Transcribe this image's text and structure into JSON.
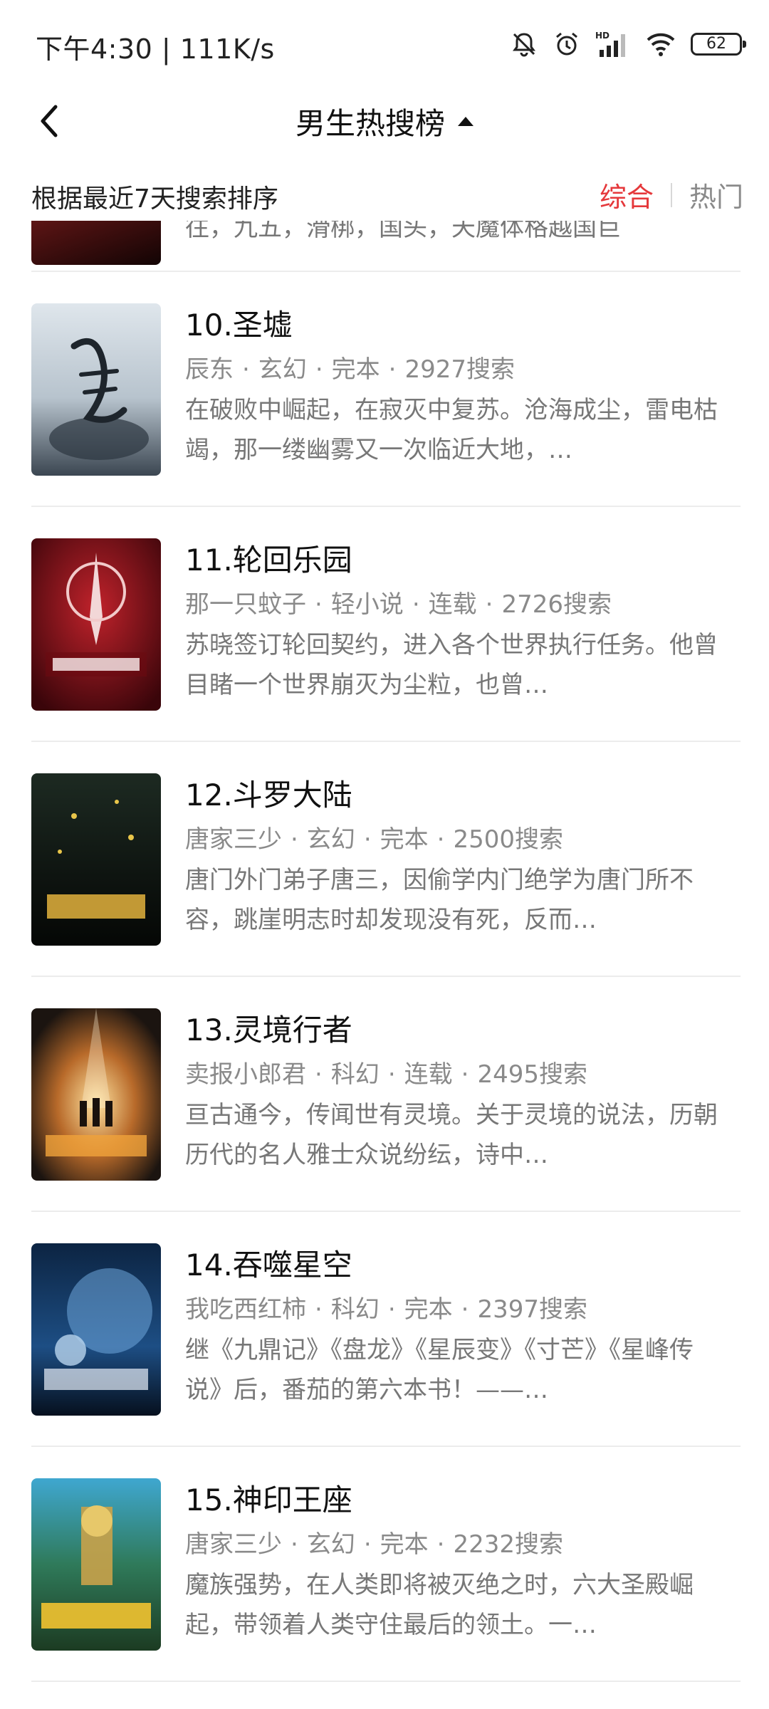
{
  "status_bar": {
    "time_speed": "下午4:30 | 111K/s",
    "battery": "62",
    "icons": [
      "mute-bell-icon",
      "alarm-icon",
      "hd-signal-icon",
      "wifi-icon",
      "battery-icon"
    ]
  },
  "header": {
    "title": "男生热搜榜",
    "back_icon": "chevron-left-icon",
    "expand_icon": "triangle-up-icon"
  },
  "subheader": {
    "note": "根据最近7天搜索排序",
    "tabs": [
      {
        "label": "综合",
        "active": true
      },
      {
        "label": "热门",
        "active": false
      }
    ]
  },
  "partial_item": {
    "desc_tail": "往，九五，滑梆，国头，天魔体格越国巨"
  },
  "books": [
    {
      "title": "10.圣墟",
      "author": "辰东",
      "genre": "玄幻",
      "status": "完本",
      "searches": "2927搜索",
      "desc": "在破败中崛起，在寂灭中复苏。沧海成尘，雷电枯竭，那一缕幽雾又一次临近大地，…"
    },
    {
      "title": "11.轮回乐园",
      "author": "那一只蚊子",
      "genre": "轻小说",
      "status": "连载",
      "searches": "2726搜索",
      "desc": "苏晓签订轮回契约，进入各个世界执行任务。他曾目睹一个世界崩灭为尘粒，也曾…"
    },
    {
      "title": "12.斗罗大陆",
      "author": "唐家三少",
      "genre": "玄幻",
      "status": "完本",
      "searches": "2500搜索",
      "desc": "唐门外门弟子唐三，因偷学内门绝学为唐门所不容，跳崖明志时却发现没有死，反而…"
    },
    {
      "title": "13.灵境行者",
      "author": "卖报小郎君",
      "genre": "科幻",
      "status": "连载",
      "searches": "2495搜索",
      "desc": "亘古通今，传闻世有灵境。关于灵境的说法，历朝历代的名人雅士众说纷纭，诗中…"
    },
    {
      "title": "14.吞噬星空",
      "author": "我吃西红柿",
      "genre": "科幻",
      "status": "完本",
      "searches": "2397搜索",
      "desc": "继《九鼎记》《盘龙》《星辰变》《寸芒》《星峰传说》后，番茄的第六本书！——…"
    },
    {
      "title": "15.神印王座",
      "author": "唐家三少",
      "genre": "玄幻",
      "status": "完本",
      "searches": "2232搜索",
      "desc": "魔族强势，在人类即将被灭绝之时，六大圣殿崛起，带领着人类守住最后的领土。一…"
    }
  ],
  "colors": {
    "accent": "#e5383b",
    "meta": "#8a8a8a",
    "divider": "#ececec"
  }
}
